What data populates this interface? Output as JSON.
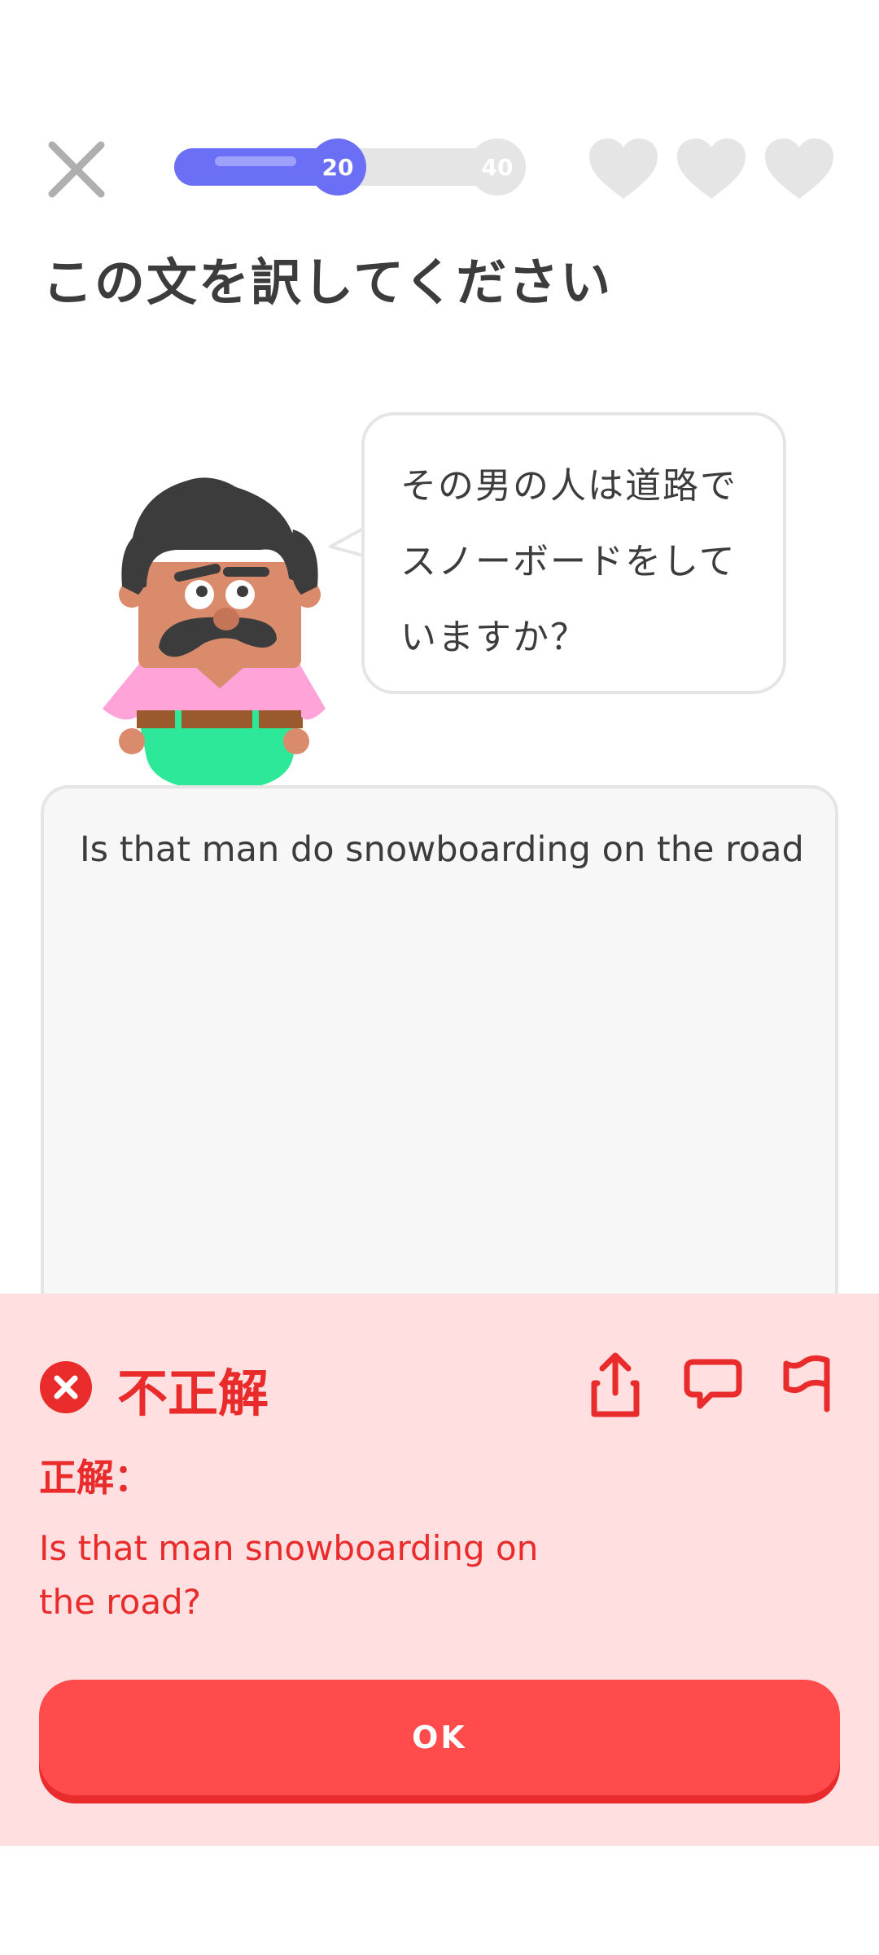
{
  "header": {
    "close_icon": "close-icon",
    "progress": {
      "current": "20",
      "goal": "40",
      "fill_fraction": 0.5,
      "fill_color": "#6b6ff5",
      "track_color": "#e5e5e5"
    },
    "hearts": {
      "count": 3,
      "color": "#e5e5e5"
    }
  },
  "prompt": {
    "title": "この文を訳してください",
    "bubble_lines": [
      "その男の人は道路で",
      "スノーボードをして",
      "いますか？"
    ]
  },
  "answer": {
    "text": "Is that man do snowboarding on the road"
  },
  "feedback": {
    "status": "不正解",
    "status_color": "#ea2b2b",
    "background": "#ffdfe0",
    "actions": [
      "share-icon",
      "comment-icon",
      "flag-icon"
    ],
    "correct_label": "正解：",
    "correct_answer": "Is that man snowboarding on the road?",
    "ok_button": "OK",
    "ok_color": "#ff4b4b"
  }
}
